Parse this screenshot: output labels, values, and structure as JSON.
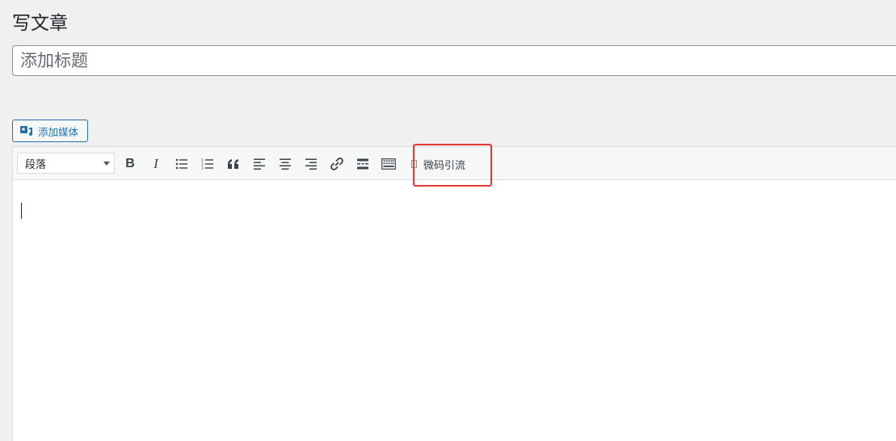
{
  "page": {
    "title": "写文章"
  },
  "title_field": {
    "placeholder": "添加标题",
    "value": ""
  },
  "media": {
    "add_media_label": "添加媒体",
    "icon": "add-media-icon"
  },
  "toolbar": {
    "format_select": {
      "selected": "段落",
      "options": [
        "段落"
      ]
    },
    "buttons": [
      {
        "name": "bold",
        "label": "B",
        "icon": "bold-icon"
      },
      {
        "name": "italic",
        "label": "I",
        "icon": "italic-icon"
      },
      {
        "name": "bullet-list",
        "icon": "bullet-list-icon"
      },
      {
        "name": "numbered-list",
        "icon": "numbered-list-icon"
      },
      {
        "name": "blockquote",
        "icon": "blockquote-icon"
      },
      {
        "name": "align-left",
        "icon": "align-left-icon"
      },
      {
        "name": "align-center",
        "icon": "align-center-icon"
      },
      {
        "name": "align-right",
        "icon": "align-right-icon"
      },
      {
        "name": "insert-link",
        "icon": "link-icon"
      },
      {
        "name": "read-more",
        "icon": "read-more-icon"
      },
      {
        "name": "toolbar-toggle",
        "icon": "keyboard-icon"
      }
    ],
    "custom_button_label": "微码引流",
    "custom_button_icon": "placeholder-box-icon"
  },
  "editor": {
    "content": ""
  },
  "colors": {
    "accent": "#2271b1",
    "highlight": "#e53935",
    "background": "#f0f0f1"
  }
}
